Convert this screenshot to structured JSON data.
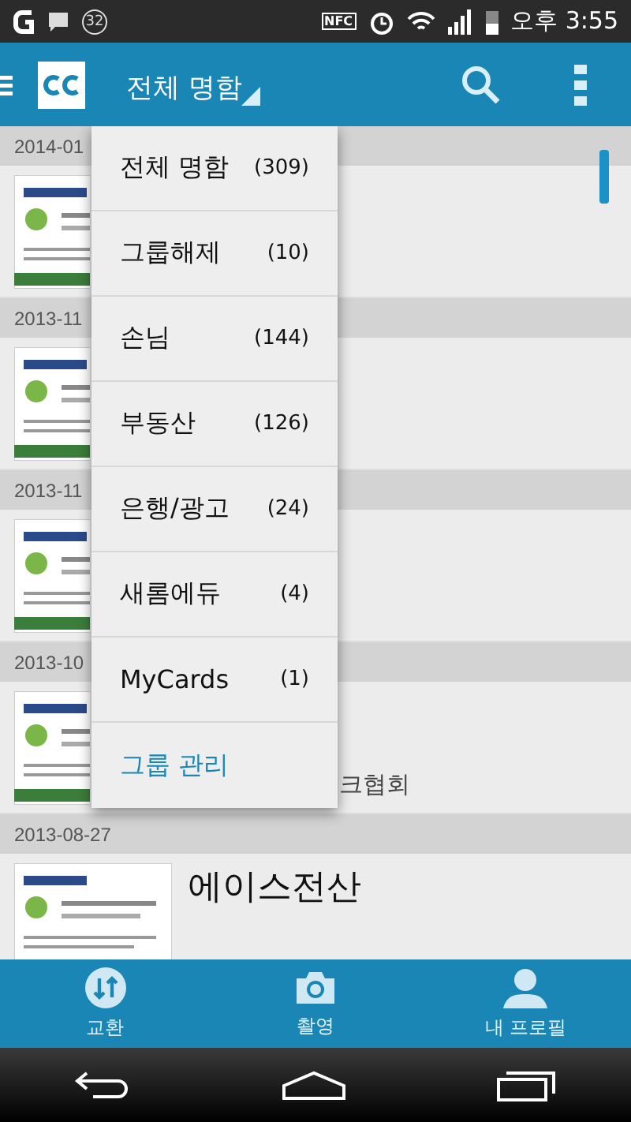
{
  "status_bar": {
    "notification_count": "32",
    "nfc": "NFC",
    "time": "오후 3:55"
  },
  "app_bar": {
    "title": "전체 명함"
  },
  "sections": [
    {
      "date": "2014-01",
      "cards": [
        {
          "kind": "card"
        }
      ]
    },
    {
      "date": "2013-11",
      "cards": [
        {
          "kind": "card"
        }
      ]
    },
    {
      "date": "2013-11",
      "cards": [
        {
          "kind": "card"
        }
      ]
    },
    {
      "date": "2013-10",
      "cards": [
        {
          "kind": "card",
          "detail": "크협회"
        }
      ]
    },
    {
      "date": "2013-08-27",
      "cards": [
        {
          "kind": "card",
          "name": "에이스전산"
        }
      ]
    }
  ],
  "menu": [
    {
      "kind": "group",
      "label": "전체 명함",
      "count": "(309)"
    },
    {
      "kind": "group",
      "label": "그룹해제",
      "count": "(10)"
    },
    {
      "kind": "group",
      "label": "손님",
      "count": "(144)"
    },
    {
      "kind": "group",
      "label": "부동산",
      "count": "(126)"
    },
    {
      "kind": "group",
      "label": "은행/광고",
      "count": "(24)"
    },
    {
      "kind": "group",
      "label": "새롬에듀",
      "count": "(4)"
    },
    {
      "kind": "group",
      "label": "MyCards",
      "count": "(1)"
    },
    {
      "kind": "action",
      "label": "그룹 관리"
    }
  ],
  "bottom_tabs": [
    {
      "kind": "exchange",
      "label": "교환"
    },
    {
      "kind": "camera",
      "label": "촬영"
    },
    {
      "kind": "profile",
      "label": "내 프로필"
    }
  ]
}
